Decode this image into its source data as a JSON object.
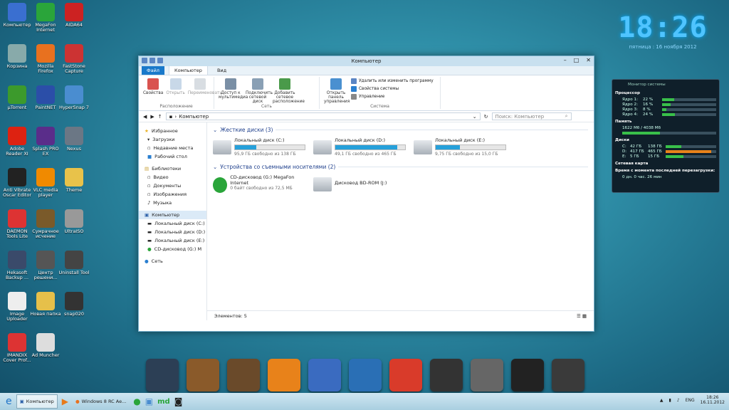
{
  "desktop": {
    "icons": [
      {
        "label": "Компьютер",
        "color": "#3a6fd0"
      },
      {
        "label": "MegaFon Internet",
        "color": "#2aa53a"
      },
      {
        "label": "AIDA64",
        "color": "#c22"
      },
      {
        "label": "Корзина",
        "color": "#8aa"
      },
      {
        "label": "Mozilla Firefox",
        "color": "#e8711f"
      },
      {
        "label": "FastStone Capture",
        "color": "#c33"
      },
      {
        "label": "µTorrent",
        "color": "#3c9a2c"
      },
      {
        "label": "PaintNET",
        "color": "#2b4ea8"
      },
      {
        "label": "HyperSnap 7",
        "color": "#4a8dd0"
      },
      {
        "label": "Adobe Reader XI",
        "color": "#d21"
      },
      {
        "label": "Splash PRO EX",
        "color": "#5a2d8a"
      },
      {
        "label": "Nexus",
        "color": "#6b7785"
      },
      {
        "label": "Anti Vibrate Oscar Editor",
        "color": "#222"
      },
      {
        "label": "VLC media player",
        "color": "#f08a00"
      },
      {
        "label": "Theme",
        "color": "#e8c24a"
      },
      {
        "label": "DAEMON Tools Lite",
        "color": "#d33"
      },
      {
        "label": "Сумрачное исчение",
        "color": "#7a5a2a"
      },
      {
        "label": "UltraISO",
        "color": "#999"
      },
      {
        "label": "Hekasoft Backup ...",
        "color": "#3a4a6a"
      },
      {
        "label": "Центр решени...",
        "color": "#555"
      },
      {
        "label": "Uninstall Tool",
        "color": "#444"
      },
      {
        "label": "Image Uploader",
        "color": "#eee"
      },
      {
        "label": "Новая папка",
        "color": "#e6c04a"
      },
      {
        "label": "snap020",
        "color": "#333"
      },
      {
        "label": "IMANDIX Cover Prof...",
        "color": "#d33"
      },
      {
        "label": "Ad Muncher",
        "color": "#ddd"
      }
    ]
  },
  "clock": {
    "time": "18:26",
    "date": "пятница : 16 ноября 2012"
  },
  "window": {
    "title": "Компьютер",
    "tabs": {
      "file": "Файл",
      "computer": "Компьютер",
      "view": "Вид"
    },
    "ribbon": {
      "location": {
        "label": "Расположение",
        "props": "Свойства",
        "open": "Открыть",
        "rename": "Переименовать"
      },
      "network": {
        "label": "Сеть",
        "media": "Доступ к мультимедиа",
        "map": "Подключить сетевой диск",
        "add": "Добавить сетевое расположение"
      },
      "system": {
        "label": "Система",
        "cp": "Открыть панель управления",
        "uninstall": "Удалить или изменить программу",
        "sysprops": "Свойства системы",
        "manage": "Управление"
      }
    },
    "address": "Компьютер",
    "search_placeholder": "Поиск: Компьютер",
    "nav": {
      "fav": "Избранное",
      "downloads": "Загрузки",
      "recent": "Недавние места",
      "desktop": "Рабочий стол",
      "libs": "Библиотеки",
      "video": "Видео",
      "docs": "Документы",
      "images": "Изображения",
      "music": "Музыка",
      "computer": "Компьютер",
      "c": "Локальный диск (C:)",
      "d": "Локальный диск (D:)",
      "e": "Локальный диск (E:)",
      "g": "CD-дисковод (G:) M",
      "net": "Сеть"
    },
    "groups": {
      "hdd": "Жесткие диски (3)",
      "removable": "Устройства со съемными носителями (2)"
    },
    "drives": [
      {
        "name": "Локальный диск (C:)",
        "free": "95,9 ГБ свободно из 138 ГБ",
        "used": 0.31
      },
      {
        "name": "Локальный диск (D:)",
        "free": "49,1 ГБ свободно из 465 ГБ",
        "used": 0.89
      },
      {
        "name": "Локальный диск (E:)",
        "free": "9,75 ГБ свободно из 15,0 ГБ",
        "used": 0.35
      }
    ],
    "removable": [
      {
        "name": "CD-дисковод (G:) MegaFon Internet",
        "free": "0 байт свободно из 72,5 МБ"
      },
      {
        "name": "Дисковод BD-ROM (J:)",
        "free": ""
      }
    ],
    "status": "Элементов: 5"
  },
  "monitor": {
    "title": "Монитор системы",
    "cpu": "Процессор",
    "cores": [
      {
        "l": "Ядро 1:",
        "v": "22 %",
        "p": 0.22
      },
      {
        "l": "Ядро 2:",
        "v": "16 %",
        "p": 0.16
      },
      {
        "l": "Ядро 3:",
        "v": "8 %",
        "p": 0.08
      },
      {
        "l": "Ядро 4:",
        "v": "24 %",
        "p": 0.24
      }
    ],
    "mem": "Память",
    "memv": "1622 Мб / 4038 Мб",
    "memp": 0.4,
    "disks": "Диски",
    "dl": [
      {
        "l": "C:",
        "a": "42 ГБ",
        "b": "138 ГБ",
        "p": 0.31
      },
      {
        "l": "D:",
        "a": "417 ГБ",
        "b": "465 ГБ",
        "p": 0.9
      },
      {
        "l": "E:",
        "a": "5 ГБ",
        "b": "15 ГБ",
        "p": 0.35
      }
    ],
    "net": "Сетевая карта",
    "up": "Время с момента последней перезагрузки:",
    "upv": "0 дн. 0 час. 26 мин"
  },
  "dock": [
    "#2c3f55",
    "#8a5a2a",
    "#6a4a2a",
    "#e8821a",
    "#3a6bc0",
    "#2a6fb5",
    "#d93b2a",
    "#333",
    "#666",
    "#222",
    "#3a3a3a"
  ],
  "taskbar": {
    "explorer": "Компьютер",
    "firefox": "Windows 8 RC Ae...",
    "lang": "ENG",
    "time": "18:26",
    "date": "16.11.2012"
  }
}
